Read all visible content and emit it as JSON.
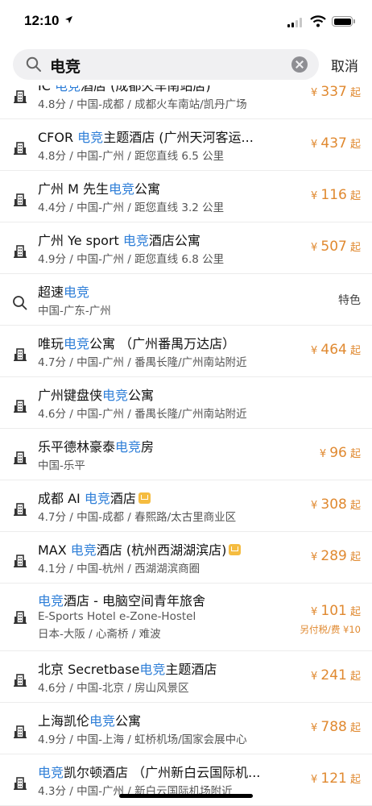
{
  "status": {
    "time": "12:10"
  },
  "search": {
    "query": "电竞",
    "cancel_label": "取消"
  },
  "items": [
    {
      "type": "hotel",
      "pre": "IC ",
      "hl": "电竞",
      "post": "酒店 (成都火车南站店)",
      "sub": "4.8分 / 中国-成都 / 成都火车南站/凯丹广场",
      "price": "337",
      "yen": "¥",
      "qi": "起"
    },
    {
      "type": "hotel",
      "pre": "CFOR ",
      "hl": "电竞",
      "post": "主题酒店 (广州天河客运...",
      "sub": "4.8分 / 中国-广州 / 距您直线 6.5 公里",
      "price": "437",
      "yen": "¥",
      "qi": "起"
    },
    {
      "type": "hotel",
      "pre": "广州 M 先生",
      "hl": "电竞",
      "post": "公寓",
      "sub": "4.4分 / 中国-广州 / 距您直线 3.2 公里",
      "price": "116",
      "yen": "¥",
      "qi": "起"
    },
    {
      "type": "hotel",
      "pre": "广州 Ye sport ",
      "hl": "电竞",
      "post": "酒店公寓",
      "sub": "4.9分 / 中国-广州 / 距您直线 6.8 公里",
      "price": "507",
      "yen": "¥",
      "qi": "起"
    },
    {
      "type": "search",
      "pre": "超速",
      "hl": "电竞",
      "post": "",
      "sub": "中国-广东-广州",
      "tag": "特色"
    },
    {
      "type": "hotel",
      "pre": "唯玩",
      "hl": "电竞",
      "post": "公寓 （广州番禺万达店）",
      "sub": "4.7分 / 中国-广州 / 番禺长隆/广州南站附近",
      "price": "464",
      "yen": "¥",
      "qi": "起"
    },
    {
      "type": "hotel",
      "pre": "广州键盘侠",
      "hl": "电竞",
      "post": "公寓",
      "sub": "4.6分 / 中国-广州 / 番禺长隆/广州南站附近"
    },
    {
      "type": "hotel",
      "pre": "乐平德林豪泰",
      "hl": "电竞",
      "post": "房",
      "sub": "中国-乐平",
      "price": "96",
      "yen": "¥",
      "qi": "起"
    },
    {
      "type": "hotel",
      "pre": "成都 AI ",
      "hl": "电竞",
      "post": "酒店",
      "crown": true,
      "sub": "4.7分 / 中国-成都 / 春熙路/太古里商业区",
      "price": "308",
      "yen": "¥",
      "qi": "起"
    },
    {
      "type": "hotel",
      "pre": "MAX ",
      "hl": "电竞",
      "post": "酒店 (杭州西湖湖滨店)",
      "crown": true,
      "sub": "4.1分 / 中国-杭州 / 西湖湖滨商圈",
      "price": "289",
      "yen": "¥",
      "qi": "起"
    },
    {
      "type": "hotel3",
      "pre": "",
      "hl": "电竞",
      "post": "酒店 - 电脑空间青年旅舍",
      "sub": "E-Sports Hotel e-Zone-Hostel",
      "sub2": "日本-大阪 / 心斋桥 / 难波",
      "price": "101",
      "yen": "¥",
      "qi": "起",
      "note": "另付税/费 ¥10"
    },
    {
      "type": "hotel",
      "pre": "北京 Secretbase",
      "hl": "电竞",
      "post": "主题酒店",
      "sub": "4.6分 / 中国-北京 / 房山风景区",
      "price": "241",
      "yen": "¥",
      "qi": "起"
    },
    {
      "type": "hotel",
      "pre": "上海凯伦",
      "hl": "电竞",
      "post": "公寓",
      "sub": "4.9分 / 中国-上海 / 虹桥机场/国家会展中心",
      "price": "788",
      "yen": "¥",
      "qi": "起"
    },
    {
      "type": "hotel",
      "pre": "",
      "hl": "电竞",
      "post": "凯尔顿酒店 （广州新白云国际机...",
      "sub": "4.3分 / 中国-广州 / 新白云国际机场附近",
      "price": "121",
      "yen": "¥",
      "qi": "起"
    }
  ]
}
